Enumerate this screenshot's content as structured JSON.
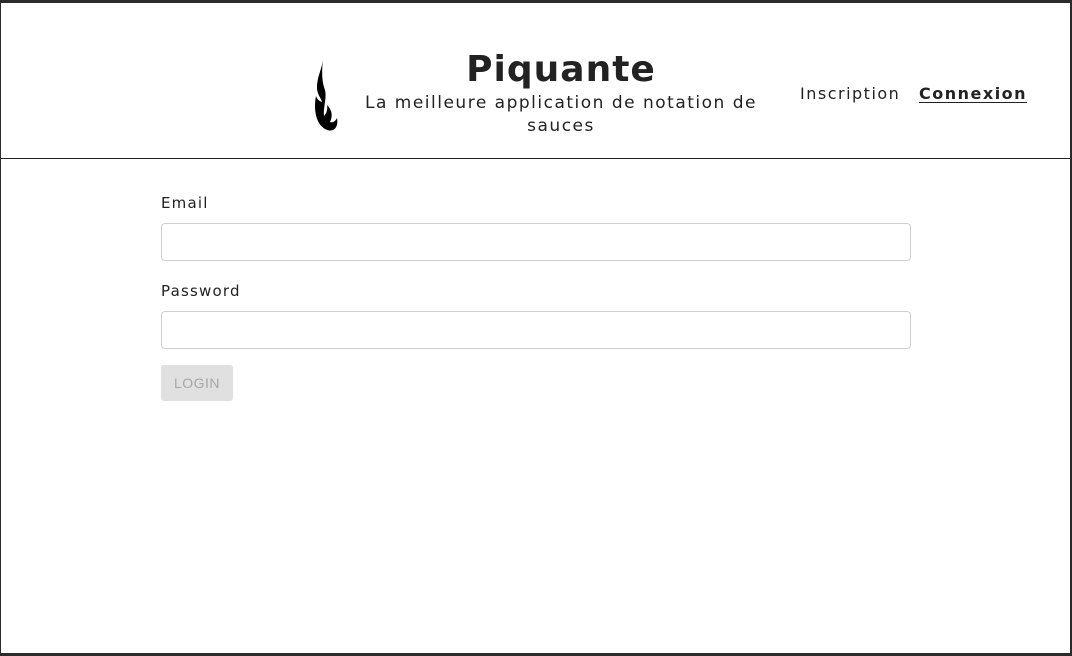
{
  "header": {
    "title": "Piquante",
    "subtitle": "La meilleure application de notation de sauces",
    "logo_icon": "flame-icon",
    "nav": {
      "signup": "Inscription",
      "login": "Connexion"
    }
  },
  "form": {
    "email_label": "Email",
    "email_value": "",
    "password_label": "Password",
    "password_value": "",
    "submit_label": "LOGIN"
  }
}
